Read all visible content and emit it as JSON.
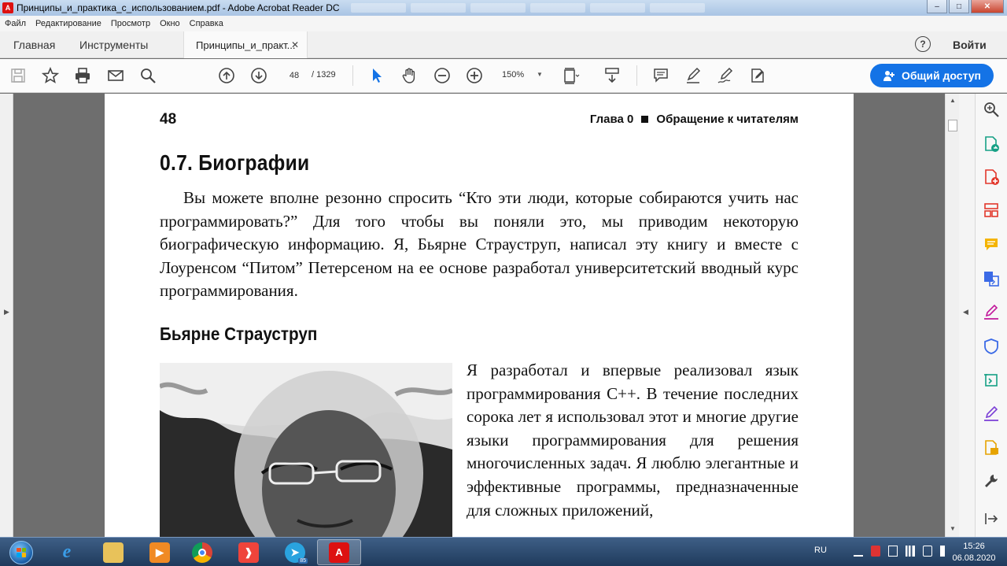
{
  "window": {
    "title": "Принципы_и_практика_с_использованием.pdf - Adobe Acrobat Reader DC",
    "app_icon_text": "A"
  },
  "menu": [
    "Файл",
    "Редактирование",
    "Просмотр",
    "Окно",
    "Справка"
  ],
  "tabs": {
    "home": "Главная",
    "tools": "Инструменты",
    "document": "Принципы_и_практ...",
    "help": "?",
    "sign_in": "Войти"
  },
  "toolbar": {
    "page_current": "48",
    "page_total": "/ 1329",
    "zoom": "150%",
    "share_label": "Общий доступ"
  },
  "page": {
    "number": "48",
    "running_head_left": "Глава 0",
    "running_head_right": "Обращение к читателям",
    "section_title": "0.7. Биографии",
    "intro": "Вы можете вполне резонно спросить “Кто эти люди, которые собираются учить нас программировать?” Для того чтобы вы поняли это, мы приводим некоторую биографическую информацию. Я, Бьярне Страуструп, написал эту книгу и вместе с Лоуренсом “Питом” Петерсеном на ее основе разработал университетский вводный курс программирования.",
    "subhead": "Бьярне Страуструп",
    "bio": "Я разработал и впервые реализовал язык программирования C++. В течение последних сорока лет я использовал этот и многие другие языки программирования для решения многочисленных задач. Я люблю элегантные и эффективные программы, предназначенные для сложных приложений,"
  },
  "taskbar": {
    "telegram_badge": "85",
    "language": "RU",
    "time": "15:26",
    "date": "06.08.2020"
  },
  "colors": {
    "accent": "#1473e6",
    "acrobat_red": "#d11"
  }
}
